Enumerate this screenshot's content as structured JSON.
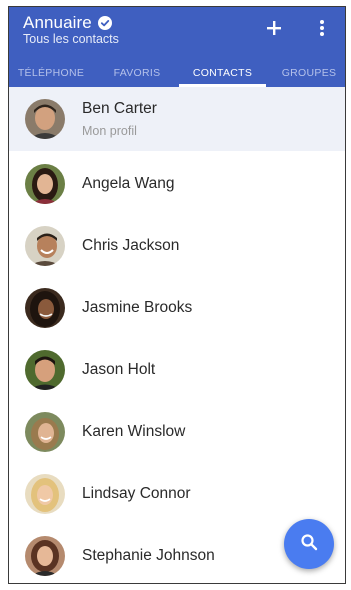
{
  "appbar": {
    "title": "Annuaire",
    "subtitle": "Tous les contacts",
    "title_icon": "check-circle-icon",
    "add_icon": "plus-icon",
    "menu_icon": "more-vert-icon",
    "color": "#3f5fc0"
  },
  "tabs": [
    {
      "label": "TÉLÉPHONE",
      "active": false
    },
    {
      "label": "FAVORIS",
      "active": false
    },
    {
      "label": "CONTACTS",
      "active": true
    },
    {
      "label": "GROUPES",
      "active": false
    }
  ],
  "profile": {
    "name": "Ben Carter",
    "subtitle": "Mon profil"
  },
  "contacts": [
    {
      "name": "Angela Wang"
    },
    {
      "name": "Chris Jackson"
    },
    {
      "name": "Jasmine Brooks"
    },
    {
      "name": "Jason Holt"
    },
    {
      "name": "Karen Winslow"
    },
    {
      "name": "Lindsay Connor"
    },
    {
      "name": "Stephanie Johnson"
    }
  ],
  "fab": {
    "icon": "search-icon",
    "color": "#4a7cf0"
  }
}
